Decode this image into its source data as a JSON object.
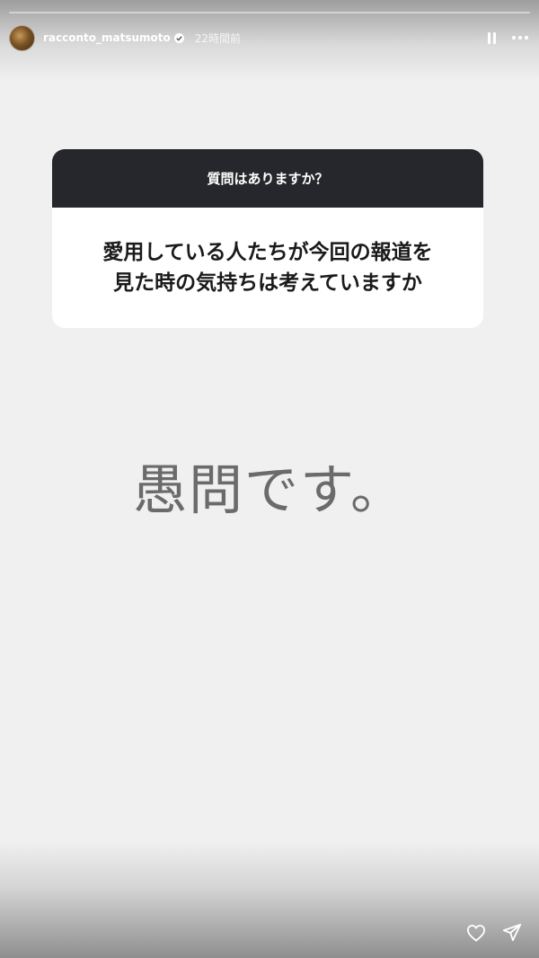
{
  "progress": {
    "segments_total": 1,
    "segments_filled": 0
  },
  "header": {
    "username": "racconto_matsumoto",
    "verified": true,
    "time_ago": "22時間前"
  },
  "question_card": {
    "prompt": "質問はありますか？",
    "question_line1": "愛用している人たちが今回の報道を",
    "question_line2": "見た時の気持ちは考えていますか"
  },
  "answer": {
    "text": "愚問です。"
  },
  "icons": {
    "pause": "pause-icon",
    "more": "more-icon",
    "like": "heart-icon",
    "share": "send-icon",
    "verified": "verified-badge-icon"
  },
  "colors": {
    "background": "#f0f0f0",
    "card_header": "#26272c",
    "answer_text": "#6b6b6b"
  }
}
